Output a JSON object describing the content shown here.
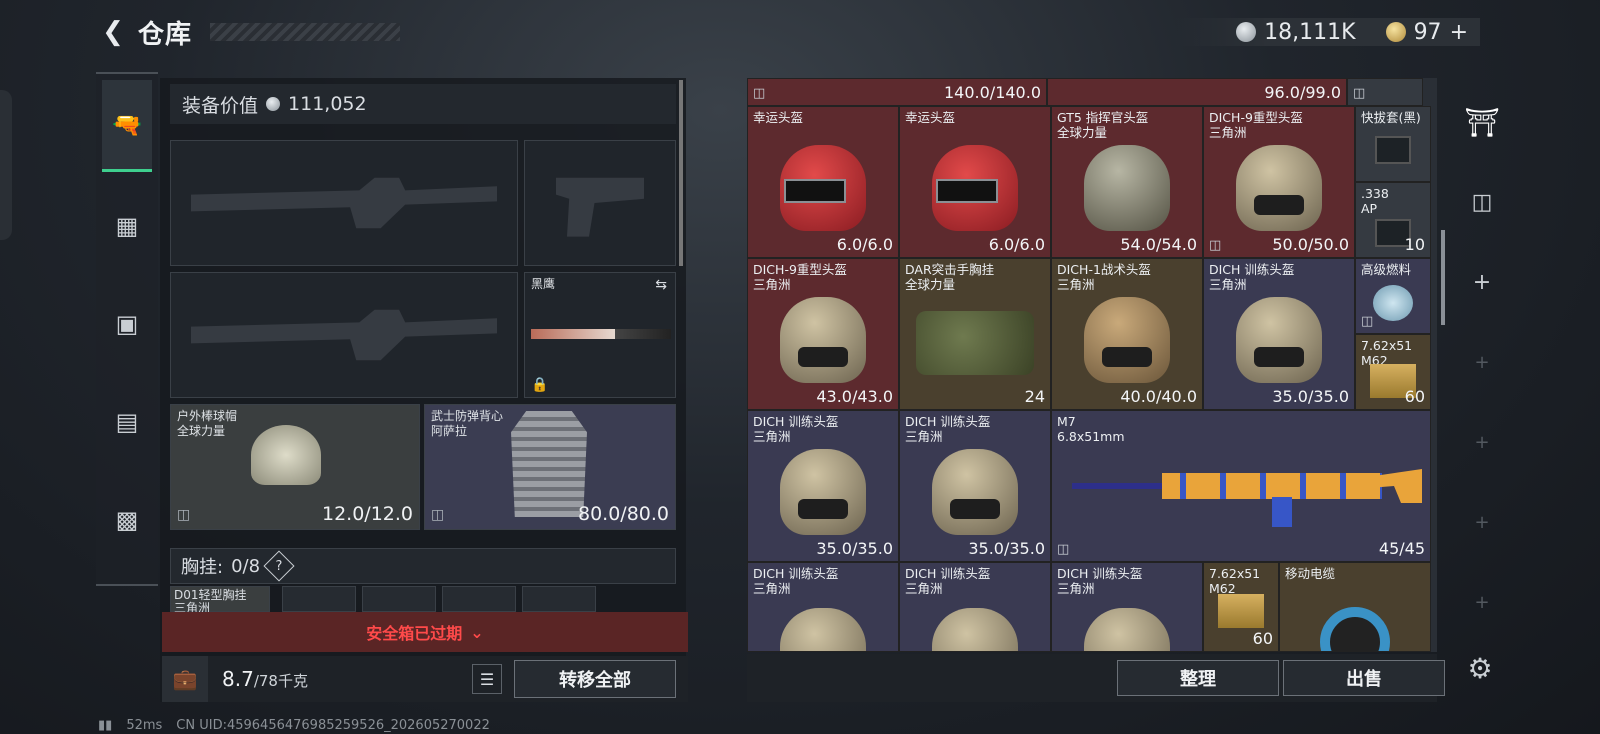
{
  "header": {
    "title": "仓库",
    "silver": "18,111K",
    "gold": "97"
  },
  "left": {
    "equip_value_label": "装备价值",
    "equip_value": "111,052",
    "knife_slot": {
      "name": "黑鹰"
    },
    "helmet_slot": {
      "name": "户外棒球帽",
      "sub": "全球力量",
      "durability": "12.0/12.0"
    },
    "armor_slot": {
      "name": "武士防弹背心",
      "sub": "阿萨拉",
      "durability": "80.0/80.0"
    },
    "chest_label": "胸挂:",
    "chest_count": "0/8",
    "chest_item": "D01轻型胸挂",
    "chest_item_sub": "三角洲",
    "safe_box": "安全箱已过期",
    "weight": "8.7",
    "weight_max": "/78千克",
    "transfer_all": "转移全部"
  },
  "grid": {
    "top_row": [
      "140.0/140.0",
      "96.0/99.0"
    ],
    "cells": [
      {
        "name": "幸运头盔",
        "value": "6.0/6.0"
      },
      {
        "name": "幸运头盔",
        "value": "6.0/6.0"
      },
      {
        "name": "GT5 指挥官头盔",
        "sub": "全球力量",
        "value": "54.0/54.0"
      },
      {
        "name": "DICH-9重型头盔",
        "sub": "三角洲",
        "value": "50.0/50.0"
      },
      {
        "name": "快拔套(黑)"
      },
      {
        "name": ".338",
        "sub": "AP",
        "value": "10"
      },
      {
        "name": "DICH-9重型头盔",
        "sub": "三角洲",
        "value": "43.0/43.0"
      },
      {
        "name": "DAR突击手胸挂",
        "sub": "全球力量",
        "value": "24"
      },
      {
        "name": "DICH-1战术头盔",
        "sub": "三角洲",
        "value": "40.0/40.0"
      },
      {
        "name": "DICH 训练头盔",
        "sub": "三角洲",
        "value": "35.0/35.0"
      },
      {
        "name": "高级燃料"
      },
      {
        "name": "7.62x51",
        "sub": "M62",
        "value": "60"
      },
      {
        "name": "DICH 训练头盔",
        "sub": "三角洲",
        "value": "35.0/35.0"
      },
      {
        "name": "DICH 训练头盔",
        "sub": "三角洲",
        "value": "35.0/35.0"
      },
      {
        "name": "M7",
        "sub": "6.8x51mm",
        "value": "45/45"
      },
      {
        "name": "DICH 训练头盔",
        "sub": "三角洲"
      },
      {
        "name": "DICH 训练头盔",
        "sub": "三角洲"
      },
      {
        "name": "DICH 训练头盔",
        "sub": "三角洲"
      },
      {
        "name": "7.62x51",
        "sub": "M62",
        "value": "60"
      },
      {
        "name": "移动电缆"
      }
    ],
    "sort": "整理",
    "sell": "出售"
  },
  "status": {
    "ping": "52ms",
    "uid": "CN UID:4596456476985259526_202605270022"
  }
}
